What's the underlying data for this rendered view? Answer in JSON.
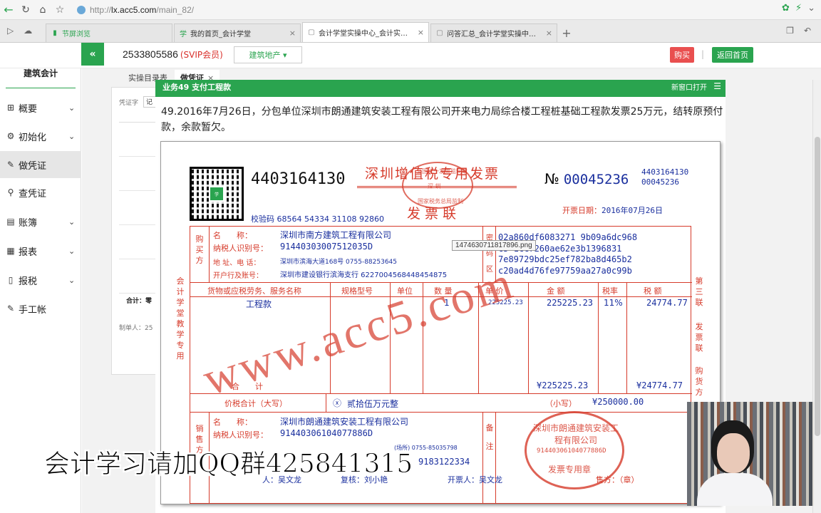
{
  "browser": {
    "url_prefix": "http://",
    "url_host": "lx.acc5.com",
    "url_path": "/main_82/",
    "tabs": [
      {
        "label": "节屏浏览",
        "active": false
      },
      {
        "label": "我的首页_会计学堂",
        "active": false
      },
      {
        "label": "会计学堂实操中心_会计实操_会",
        "active": true
      },
      {
        "label": "问答汇总_会计学堂实操中心_会",
        "active": false
      }
    ]
  },
  "header": {
    "account": "2533805586",
    "vip": "(SVIP会员)",
    "industry": "建筑地产 ▾",
    "buy": "购买",
    "separator": "|",
    "home": "返回首页"
  },
  "sidebar": {
    "brand": "建筑会计",
    "items": [
      {
        "label": "概要",
        "icon": "grid-icon",
        "chevron": true
      },
      {
        "label": "初始化",
        "icon": "gear-icon",
        "chevron": true
      },
      {
        "label": "做凭证",
        "icon": "pen-icon",
        "chevron": false,
        "active": true
      },
      {
        "label": "查凭证",
        "icon": "search-icon",
        "chevron": false
      },
      {
        "label": "账簿",
        "icon": "book-icon",
        "chevron": true
      },
      {
        "label": "报表",
        "icon": "report-icon",
        "chevron": true
      },
      {
        "label": "报税",
        "icon": "document-icon",
        "chevron": true
      },
      {
        "label": "手工帐",
        "icon": "pen-icon",
        "chevron": false
      }
    ]
  },
  "subtabs": [
    {
      "label": "实操目录表",
      "active": false
    },
    {
      "label": "做凭证",
      "active": true,
      "close": "×"
    }
  ],
  "voucher": {
    "label": "凭证字",
    "value": "记",
    "total": "合计：零",
    "maker": "制单人：25"
  },
  "question": {
    "header_title": "业务49 支付工程款",
    "header_right": "新窗口打开",
    "text": "49.2016年7月26日，分包单位深圳市朗通建筑安装工程有限公司开来电力局综合楼工程桩基础工程款发票25万元，结转原预付款，余款暂欠。"
  },
  "invoice": {
    "code": "4403164130",
    "check_code": "校验码 68564 54334 31108 92860",
    "title": "深圳增值税专用发票",
    "copy": "发票联",
    "stamp_top": "全国统一发票监制章",
    "stamp_mid": "深  圳",
    "stamp_bottom": "国家税务总局监制",
    "no_label": "№",
    "no": "00045236",
    "no_small_1": "4403164130",
    "no_small_2": "00045236",
    "date_label": "开票日期：",
    "date": "2016年07月26日",
    "buyer_label": "购买方",
    "buyer": {
      "name_label": "名　　称：",
      "name": "深圳市南方建筑工程有限公司",
      "tax_label": "纳税人识别号：",
      "tax": "91440303007512035D",
      "addr_label": "地 址、电 话：",
      "addr": "深圳市滨海大道168号 0755-88253645",
      "bank_label": "开户行及账号：",
      "bank": "深圳市建设银行滨海支行 6227004568448454875"
    },
    "pwd_label": "密码区",
    "pwd_lines": [
      "02a860df6083271 9b09a6dc968",
      "c5 1cc7260ae62e3b1396831",
      "7e89729bdc25ef782ba8d465b2",
      "c20ad4d76fe97759aa27a0c99b"
    ],
    "cols": {
      "goods": "货物或应税劳务、服务名称",
      "spec": "规格型号",
      "unit": "单位",
      "qty": "数 量",
      "price": "单 价",
      "amount": "金 额",
      "rate": "税率",
      "tax": "税 额"
    },
    "row": {
      "goods": "工程款",
      "qty": "1",
      "price": "225225.23",
      "amount": "225225.23",
      "rate": "11%",
      "tax": "24774.77"
    },
    "total_label": "合　　计",
    "total_amount": "¥225225.23",
    "total_tax": "¥24774.77",
    "grand_label": "价税合计（大写）",
    "grand_icon": "ⓧ",
    "grand_upper": "贰拾伍万元整",
    "grand_small_label": "（小写）",
    "grand_small": "¥250000.00",
    "seller_label": "销售方",
    "seller": {
      "name_label": "名　　称：",
      "name": "深圳市朗通建筑安装工程有限公司",
      "tax_label": "纳税人识别号：",
      "tax": "91440306104077886D",
      "addr_tail": "(场所) 0755-85035798",
      "bank_tail": "9183122334"
    },
    "remark_label": "备注",
    "left_vertical": "会计学堂教学专用",
    "right_vertical_1": "第三联",
    "right_vertical_2": "发票联",
    "right_vertical_3": "购货方",
    "payee": "人：吴文龙",
    "reviewer": "复核：刘小艳",
    "drawer": "开票人：吴文龙",
    "seller_sign": "售方：（章）",
    "watermark": "www.acc5.com",
    "round_stamp_name": "深圳市朗通建筑安装工程有限公司",
    "round_stamp_tax": "91440306104077886D",
    "round_stamp_use": "发票专用章",
    "tooltip": "1474630711817896.png"
  },
  "caption": "会计学习请加QQ群425841315"
}
